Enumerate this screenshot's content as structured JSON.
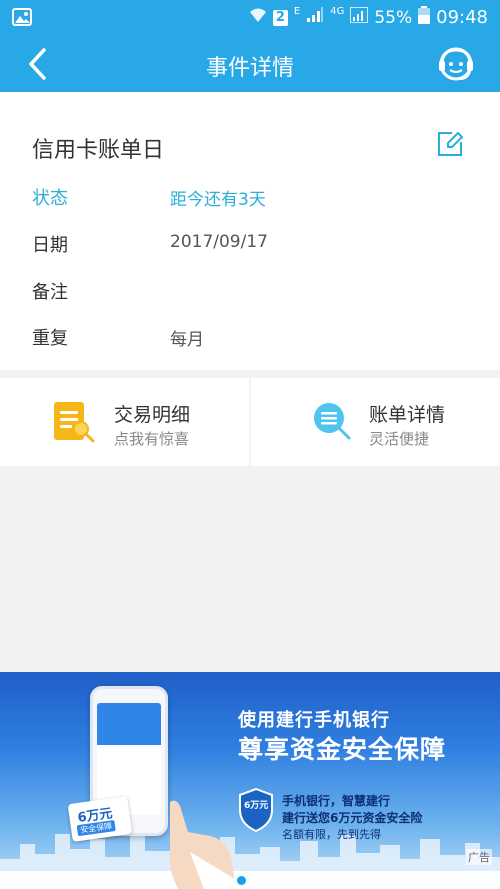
{
  "status_bar": {
    "image_icon": "image-icon",
    "wifi_icon": "wifi-icon",
    "badge": "2",
    "network_e": "E",
    "network_4g": "4G",
    "battery": "55%",
    "time": "09:48"
  },
  "header": {
    "title": "事件详情",
    "back_icon": "back-arrow-icon",
    "service_icon": "customer-service-icon"
  },
  "event": {
    "title": "信用卡账单日",
    "edit_icon": "edit-icon",
    "rows": [
      {
        "label": "状态",
        "value": "距今还有3天"
      },
      {
        "label": "日期",
        "value": "2017/09/17"
      },
      {
        "label": "备注",
        "value": ""
      },
      {
        "label": "重复",
        "value": "每月"
      }
    ]
  },
  "actions": [
    {
      "title": "交易明细",
      "subtitle": "点我有惊喜",
      "icon": "transaction-doc-icon"
    },
    {
      "title": "账单详情",
      "subtitle": "灵活便捷",
      "icon": "bill-search-icon"
    }
  ],
  "banner": {
    "headline1": "使用建行手机银行",
    "headline2": "尊享资金安全保障",
    "shield_text": "6万元",
    "card_text": "6万元",
    "card_sub": "安全保障",
    "line1": "手机银行，智慧建行",
    "line2": "建行送您6万元资金安全险",
    "line3": "名额有限，先到先得",
    "ad_label": "广告",
    "dots": 2,
    "active_dot": 0
  },
  "colors": {
    "primary": "#29a8e8",
    "accent_text": "#2aaedb",
    "icon_yellow": "#f5b617",
    "icon_blue": "#4ec4ee"
  }
}
